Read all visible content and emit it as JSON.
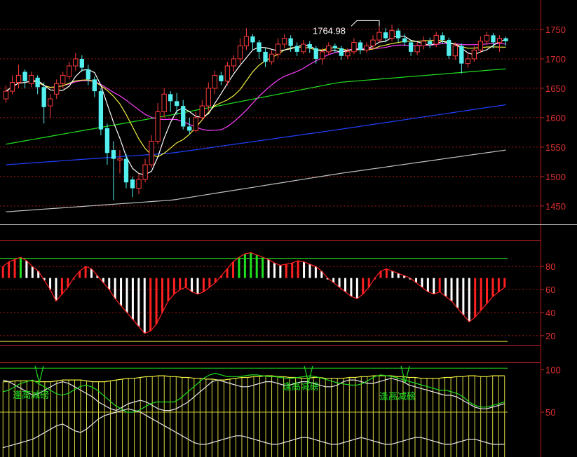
{
  "chart_data": [
    {
      "panel": "price",
      "type": "candlestick",
      "y_ticks": [
        1750,
        1700,
        1650,
        1600,
        1550,
        1500,
        1450
      ],
      "ylim": [
        1420,
        1800
      ],
      "grid": "dotted red horizontal",
      "high_annotation": {
        "label": "1764.98",
        "value": 1764.98
      },
      "colors": {
        "up": "#ff3b3b",
        "down": "#54f0f0",
        "ma5": "#ffffff",
        "ma10": "#f0f040",
        "ma20": "#ff40ff",
        "ma60": "#20e020",
        "ma120": "#2040ff",
        "ma250": "#c0c0c0"
      },
      "candles": [
        {
          "o": 1632,
          "c": 1645,
          "h": 1655,
          "l": 1625
        },
        {
          "o": 1645,
          "c": 1660,
          "h": 1672,
          "l": 1640
        },
        {
          "o": 1660,
          "c": 1672,
          "h": 1690,
          "l": 1650
        },
        {
          "o": 1678,
          "c": 1662,
          "h": 1682,
          "l": 1650
        },
        {
          "o": 1658,
          "c": 1672,
          "h": 1678,
          "l": 1652
        },
        {
          "o": 1668,
          "c": 1652,
          "h": 1672,
          "l": 1640
        },
        {
          "o": 1652,
          "c": 1618,
          "h": 1660,
          "l": 1590
        },
        {
          "o": 1620,
          "c": 1632,
          "h": 1640,
          "l": 1600
        },
        {
          "o": 1640,
          "c": 1658,
          "h": 1665,
          "l": 1632
        },
        {
          "o": 1658,
          "c": 1672,
          "h": 1678,
          "l": 1650
        },
        {
          "o": 1670,
          "c": 1688,
          "h": 1695,
          "l": 1665
        },
        {
          "o": 1688,
          "c": 1700,
          "h": 1710,
          "l": 1680
        },
        {
          "o": 1700,
          "c": 1685,
          "h": 1706,
          "l": 1678
        },
        {
          "o": 1682,
          "c": 1665,
          "h": 1690,
          "l": 1655
        },
        {
          "o": 1665,
          "c": 1645,
          "h": 1670,
          "l": 1635
        },
        {
          "o": 1645,
          "c": 1580,
          "h": 1650,
          "l": 1570
        },
        {
          "o": 1582,
          "c": 1540,
          "h": 1590,
          "l": 1520
        },
        {
          "o": 1545,
          "c": 1530,
          "h": 1560,
          "l": 1460
        },
        {
          "o": 1528,
          "c": 1530,
          "h": 1545,
          "l": 1505
        },
        {
          "o": 1530,
          "c": 1490,
          "h": 1538,
          "l": 1480
        },
        {
          "o": 1495,
          "c": 1480,
          "h": 1500,
          "l": 1465
        },
        {
          "o": 1480,
          "c": 1495,
          "h": 1505,
          "l": 1470
        },
        {
          "o": 1495,
          "c": 1520,
          "h": 1530,
          "l": 1490
        },
        {
          "o": 1520,
          "c": 1560,
          "h": 1570,
          "l": 1515
        },
        {
          "o": 1560,
          "c": 1610,
          "h": 1625,
          "l": 1555
        },
        {
          "o": 1610,
          "c": 1640,
          "h": 1650,
          "l": 1600
        },
        {
          "o": 1640,
          "c": 1628,
          "h": 1645,
          "l": 1610
        },
        {
          "o": 1628,
          "c": 1620,
          "h": 1642,
          "l": 1605
        },
        {
          "o": 1620,
          "c": 1585,
          "h": 1630,
          "l": 1580
        },
        {
          "o": 1585,
          "c": 1578,
          "h": 1600,
          "l": 1572
        },
        {
          "o": 1578,
          "c": 1600,
          "h": 1610,
          "l": 1575
        },
        {
          "o": 1600,
          "c": 1620,
          "h": 1630,
          "l": 1595
        },
        {
          "o": 1620,
          "c": 1650,
          "h": 1660,
          "l": 1612
        },
        {
          "o": 1650,
          "c": 1672,
          "h": 1680,
          "l": 1640
        },
        {
          "o": 1672,
          "c": 1662,
          "h": 1678,
          "l": 1655
        },
        {
          "o": 1662,
          "c": 1688,
          "h": 1695,
          "l": 1655
        },
        {
          "o": 1688,
          "c": 1700,
          "h": 1706,
          "l": 1678
        },
        {
          "o": 1700,
          "c": 1722,
          "h": 1735,
          "l": 1692
        },
        {
          "o": 1722,
          "c": 1738,
          "h": 1752,
          "l": 1715
        },
        {
          "o": 1738,
          "c": 1728,
          "h": 1742,
          "l": 1715
        },
        {
          "o": 1728,
          "c": 1712,
          "h": 1732,
          "l": 1700
        },
        {
          "o": 1712,
          "c": 1695,
          "h": 1718,
          "l": 1686
        },
        {
          "o": 1695,
          "c": 1708,
          "h": 1715,
          "l": 1690
        },
        {
          "o": 1708,
          "c": 1725,
          "h": 1735,
          "l": 1702
        },
        {
          "o": 1725,
          "c": 1735,
          "h": 1742,
          "l": 1718
        },
        {
          "o": 1735,
          "c": 1722,
          "h": 1740,
          "l": 1712
        },
        {
          "o": 1722,
          "c": 1712,
          "h": 1728,
          "l": 1705
        },
        {
          "o": 1712,
          "c": 1725,
          "h": 1732,
          "l": 1708
        },
        {
          "o": 1725,
          "c": 1718,
          "h": 1730,
          "l": 1710
        },
        {
          "o": 1718,
          "c": 1700,
          "h": 1722,
          "l": 1692
        },
        {
          "o": 1700,
          "c": 1712,
          "h": 1718,
          "l": 1690
        },
        {
          "o": 1712,
          "c": 1722,
          "h": 1728,
          "l": 1706
        },
        {
          "o": 1722,
          "c": 1718,
          "h": 1726,
          "l": 1710
        },
        {
          "o": 1718,
          "c": 1705,
          "h": 1722,
          "l": 1698
        },
        {
          "o": 1705,
          "c": 1712,
          "h": 1718,
          "l": 1700
        },
        {
          "o": 1712,
          "c": 1728,
          "h": 1735,
          "l": 1708
        },
        {
          "o": 1728,
          "c": 1715,
          "h": 1732,
          "l": 1708
        },
        {
          "o": 1715,
          "c": 1722,
          "h": 1728,
          "l": 1710
        },
        {
          "o": 1722,
          "c": 1732,
          "h": 1740,
          "l": 1716
        },
        {
          "o": 1732,
          "c": 1745,
          "h": 1765,
          "l": 1728
        },
        {
          "o": 1745,
          "c": 1735,
          "h": 1752,
          "l": 1728
        },
        {
          "o": 1735,
          "c": 1748,
          "h": 1758,
          "l": 1730
        },
        {
          "o": 1748,
          "c": 1735,
          "h": 1752,
          "l": 1728
        },
        {
          "o": 1735,
          "c": 1728,
          "h": 1742,
          "l": 1722
        },
        {
          "o": 1728,
          "c": 1712,
          "h": 1732,
          "l": 1705
        },
        {
          "o": 1712,
          "c": 1722,
          "h": 1728,
          "l": 1706
        },
        {
          "o": 1722,
          "c": 1730,
          "h": 1738,
          "l": 1716
        },
        {
          "o": 1730,
          "c": 1725,
          "h": 1736,
          "l": 1718
        },
        {
          "o": 1725,
          "c": 1740,
          "h": 1746,
          "l": 1720
        },
        {
          "o": 1740,
          "c": 1732,
          "h": 1745,
          "l": 1725
        },
        {
          "o": 1732,
          "c": 1705,
          "h": 1736,
          "l": 1700
        },
        {
          "o": 1705,
          "c": 1722,
          "h": 1728,
          "l": 1698
        },
        {
          "o": 1722,
          "c": 1692,
          "h": 1726,
          "l": 1675
        },
        {
          "o": 1692,
          "c": 1700,
          "h": 1710,
          "l": 1685
        },
        {
          "o": 1700,
          "c": 1715,
          "h": 1722,
          "l": 1695
        },
        {
          "o": 1715,
          "c": 1730,
          "h": 1738,
          "l": 1710
        },
        {
          "o": 1730,
          "c": 1740,
          "h": 1746,
          "l": 1724
        },
        {
          "o": 1740,
          "c": 1728,
          "h": 1744,
          "l": 1718
        },
        {
          "o": 1728,
          "c": 1735,
          "h": 1740,
          "l": 1712
        },
        {
          "o": 1735,
          "c": 1730,
          "h": 1738,
          "l": 1722
        }
      ],
      "moving_averages": {
        "ma60": [
          1555,
          1605,
          1660,
          1683
        ],
        "ma120": [
          1520,
          1540,
          1580,
          1622
        ],
        "ma250": [
          1440,
          1460,
          1505,
          1545
        ]
      }
    },
    {
      "panel": "oscillator",
      "type": "histogram",
      "y_ticks": [
        80,
        60,
        40,
        20
      ],
      "ylim": [
        12,
        102
      ],
      "reference_lines": [
        {
          "value": 87,
          "color": "#20e020"
        },
        {
          "value": 15,
          "color": "#f0f040"
        }
      ],
      "values": [
        80,
        84,
        86,
        88,
        85,
        80,
        76,
        68,
        60,
        50,
        56,
        62,
        70,
        76,
        80,
        78,
        72,
        66,
        60,
        52,
        46,
        40,
        34,
        28,
        22,
        24,
        30,
        40,
        50,
        56,
        60,
        62,
        58,
        56,
        58,
        62,
        66,
        72,
        78,
        84,
        88,
        91,
        92,
        90,
        88,
        86,
        83,
        81,
        82,
        83,
        85,
        84,
        82,
        80,
        76,
        70,
        66,
        62,
        58,
        54,
        52,
        56,
        62,
        70,
        76,
        78,
        76,
        74,
        72,
        70,
        66,
        62,
        58,
        56,
        58,
        54,
        50,
        44,
        38,
        32,
        36,
        42,
        48,
        54,
        58,
        62
      ]
    },
    {
      "panel": "signal",
      "type": "line",
      "y_ticks": [
        100,
        50
      ],
      "ylim": [
        -3,
        108
      ],
      "annotations": [
        "逢高减磅",
        "逢高减磅",
        "逢高减磅"
      ],
      "reference_lines": [
        {
          "value": 102,
          "color": "#20e020"
        },
        {
          "value": 50,
          "color": "#c8c830"
        }
      ],
      "series_yellow": [
        86,
        86,
        87,
        87,
        87,
        87,
        86,
        86,
        86,
        87,
        88,
        88,
        88,
        88,
        87,
        86,
        86,
        86,
        87,
        88,
        89,
        90,
        90,
        91,
        92,
        92,
        93,
        93,
        92,
        92,
        91,
        91,
        90,
        90,
        89,
        89,
        88,
        88,
        89,
        90,
        91,
        91,
        92,
        92,
        93,
        93,
        92,
        92,
        91,
        91,
        90,
        90,
        91,
        91,
        90,
        90,
        90,
        90,
        91,
        91,
        92,
        92,
        93,
        93,
        93,
        93,
        92,
        92,
        91,
        91,
        90,
        90,
        90,
        90,
        91,
        91,
        92,
        92,
        93,
        93,
        92,
        92,
        93,
        93,
        93
      ],
      "series_green": [
        74,
        76,
        80,
        84,
        86,
        88,
        84,
        80,
        76,
        72,
        70,
        72,
        76,
        80,
        82,
        80,
        76,
        70,
        64,
        58,
        54,
        50,
        50,
        52,
        56,
        60,
        62,
        62,
        62,
        62,
        66,
        72,
        78,
        84,
        90,
        94,
        96,
        94,
        92,
        92,
        92,
        93,
        94,
        94,
        93,
        92,
        92,
        91,
        90,
        90,
        91,
        92,
        93,
        92,
        90,
        88,
        86,
        84,
        83,
        82,
        82,
        84,
        88,
        92,
        94,
        93,
        92,
        90,
        88,
        86,
        84,
        82,
        80,
        78,
        76,
        76,
        74,
        72,
        68,
        62,
        58,
        56,
        56,
        58,
        60,
        62
      ],
      "series_white1": [
        88,
        86,
        82,
        78,
        74,
        70,
        72,
        76,
        80,
        84,
        86,
        84,
        80,
        76,
        72,
        68,
        62,
        58,
        54,
        52,
        56,
        60,
        62,
        64,
        62,
        58,
        54,
        52,
        52,
        54,
        58,
        62,
        68,
        74,
        80,
        86,
        88,
        86,
        84,
        82,
        80,
        80,
        82,
        84,
        86,
        86,
        84,
        82,
        82,
        84,
        86,
        86,
        84,
        82,
        80,
        80,
        82,
        86,
        88,
        88,
        86,
        84,
        84,
        86,
        88,
        90,
        88,
        86,
        82,
        80,
        78,
        76,
        74,
        72,
        70,
        70,
        68,
        64,
        60,
        56,
        54,
        54,
        56,
        58,
        60
      ],
      "series_white2": [
        8,
        10,
        12,
        14,
        16,
        18,
        22,
        26,
        30,
        34,
        36,
        32,
        28,
        26,
        30,
        36,
        42,
        46,
        48,
        50,
        52,
        54,
        52,
        50,
        46,
        42,
        38,
        34,
        30,
        26,
        22,
        18,
        14,
        12,
        12,
        14,
        16,
        18,
        20,
        22,
        22,
        20,
        18,
        16,
        14,
        12,
        12,
        14,
        16,
        18,
        20,
        20,
        18,
        16,
        14,
        12,
        12,
        14,
        16,
        18,
        20,
        18,
        16,
        14,
        12,
        12,
        14,
        16,
        18,
        20,
        20,
        18,
        16,
        14,
        12,
        12,
        14,
        16,
        18,
        18,
        16,
        14,
        12,
        12,
        12
      ]
    }
  ]
}
